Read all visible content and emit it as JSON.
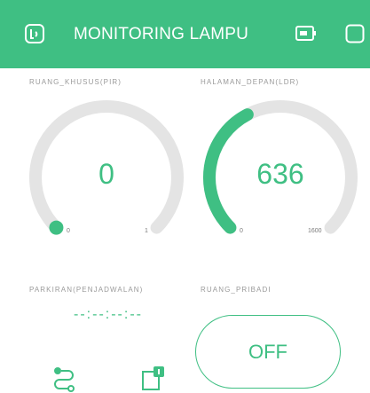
{
  "header": {
    "title": "MONITORING LAMPU",
    "accent_color": "#3fbf83",
    "icons": [
      "app-logo-icon",
      "battery-icon",
      "square-icon"
    ]
  },
  "gauges": [
    {
      "label": "RUANG_KHUSUS(PIR)",
      "value": "0",
      "min": "0",
      "max": "1",
      "fraction": 0.0
    },
    {
      "label": "HALAMAN_DEPAN(LDR)",
      "value": "636",
      "min": "0",
      "max": "1600",
      "fraction": 0.3975
    }
  ],
  "scheduler": {
    "label": "PARKIRAN(PENJADWALAN)",
    "time": "--:--:--:--",
    "icons": [
      "route-icon",
      "calendar-icon"
    ]
  },
  "switch": {
    "label": "RUANG_PRIBADI",
    "state": "OFF"
  }
}
